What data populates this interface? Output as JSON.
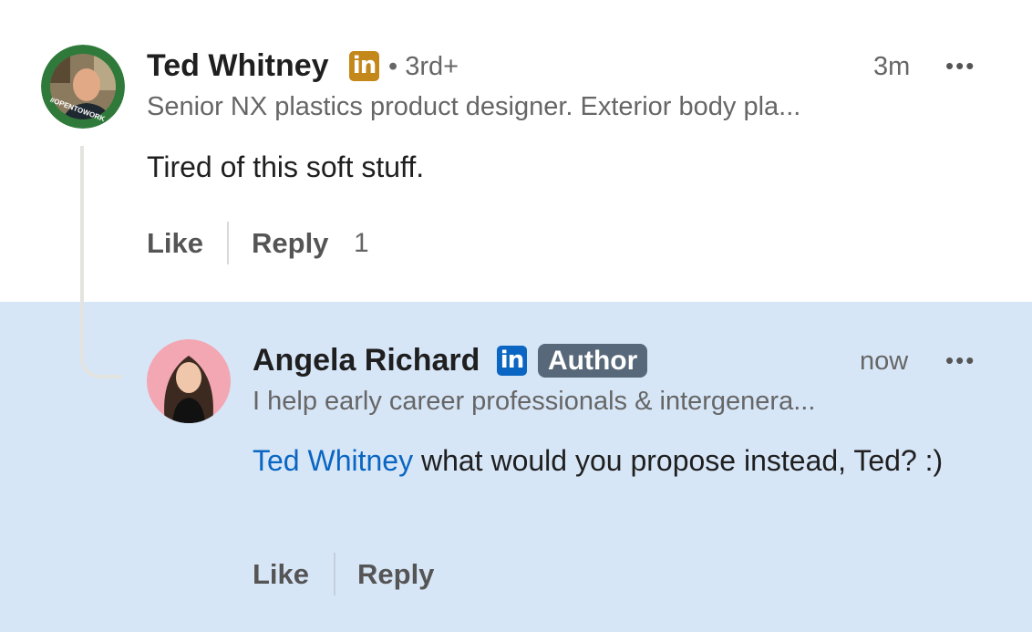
{
  "comment": {
    "author": "Ted Whitney",
    "degree": "• 3rd+",
    "time": "3m",
    "more": "•••",
    "headline": "Senior NX plastics product designer. Exterior body pla...",
    "text": "Tired of this soft stuff.",
    "like_label": "Like",
    "reply_label": "Reply",
    "reply_count": "1",
    "avatar_frame_text": "#OPENTOWORK",
    "badge_icon": "linkedin-gold-icon"
  },
  "reply": {
    "author": "Angela Richard",
    "badge": "Author",
    "time": "now",
    "more": "•••",
    "headline": "I help early career professionals & intergenera...",
    "mention": "Ted Whitney",
    "text": " what would you propose instead, Ted? :)",
    "like_label": "Like",
    "reply_label": "Reply",
    "badge_icon": "linkedin-blue-icon"
  },
  "colors": {
    "reply_bg": "#d7e6f7",
    "mention": "#0a66c2",
    "premium_badge": "#c3871a",
    "linkedin_blue": "#0a66c2",
    "author_badge": "#56687a"
  }
}
